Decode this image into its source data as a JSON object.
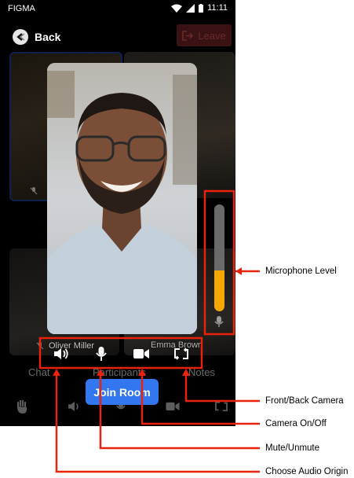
{
  "status_bar": {
    "carrier": "FIGMA",
    "time": "11:11"
  },
  "header": {
    "back_label": "Back",
    "leave_label": "Leave"
  },
  "participants": {
    "tile_names": [
      "Oliver Miller",
      "Emma Brown"
    ]
  },
  "preview_controls": {
    "audio_origin_icon": "speaker-icon",
    "mute_icon": "microphone-icon",
    "camera_icon": "video-camera-icon",
    "flip_icon": "camera-flip-icon"
  },
  "microphone_level": {
    "level": 0.38,
    "color": "#f5a800"
  },
  "tabs": [
    "Chat",
    "Participants",
    "Notes"
  ],
  "join_button": {
    "label": "Join Room",
    "color": "#3276f0"
  },
  "annotations": {
    "microphone_level": "Microphone Level",
    "front_back_camera": "Front/Back Camera",
    "camera_on_off": "Camera On/Off",
    "mute_unmute": "Mute/Unmute",
    "choose_audio_origin": "Choose Audio Origin",
    "highlight_color": "#e8220b"
  }
}
